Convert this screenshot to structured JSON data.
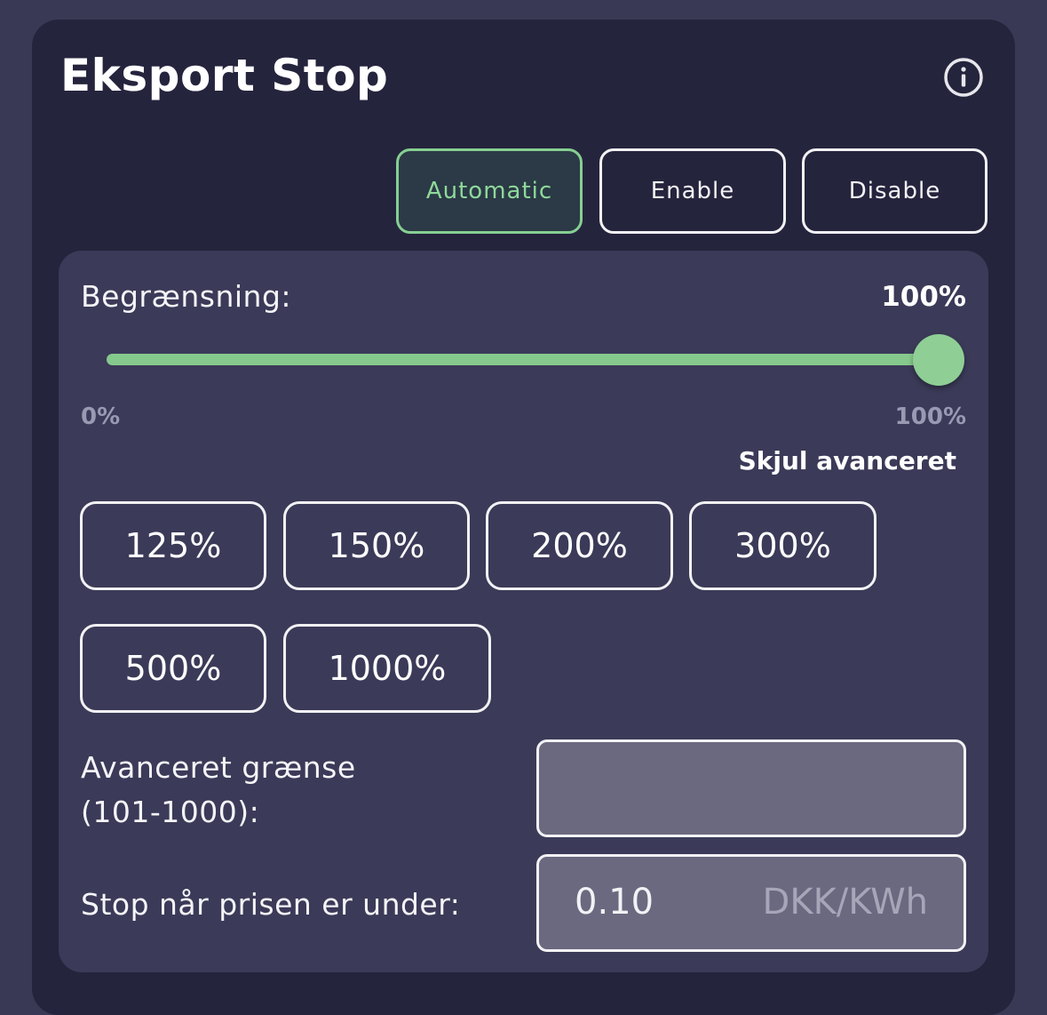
{
  "card": {
    "title": "Eksport Stop",
    "info_icon": "info-circle-icon"
  },
  "mode": {
    "options": [
      "Automatic",
      "Enable",
      "Disable"
    ],
    "selected": "Automatic",
    "accent_color": "#86cf92"
  },
  "limit": {
    "label": "Begrænsning:",
    "value_text": "100%",
    "slider_fraction": 1.0,
    "min_label": "0%",
    "max_label": "100%",
    "slider_color": "#86c98c"
  },
  "advanced": {
    "toggle_label": "Skjul avanceret",
    "presets": [
      "125%",
      "150%",
      "200%",
      "300%",
      "500%",
      "1000%"
    ],
    "custom_limit_label_line1": "Avanceret grænse",
    "custom_limit_label_line2": "(101-1000):",
    "custom_limit_value": ""
  },
  "price": {
    "label": "Stop når prisen er under:",
    "value": "0.10",
    "unit": "DKK/KWh"
  }
}
